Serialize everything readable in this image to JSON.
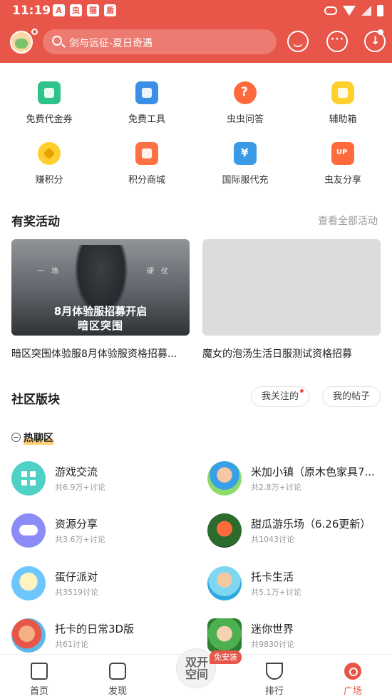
{
  "status_bar": {
    "time": "11:19",
    "icons": [
      "A",
      "虫",
      "猫",
      "盾"
    ]
  },
  "header": {
    "search_placeholder": "剑与远征-夏日奇遇"
  },
  "tools": [
    {
      "label": "免费代金券",
      "icon": "ticket-icon"
    },
    {
      "label": "免费工具",
      "icon": "wrench-icon"
    },
    {
      "label": "虫虫问答",
      "icon": "question-icon"
    },
    {
      "label": "辅助箱",
      "icon": "helper-icon"
    },
    {
      "label": "赚积分",
      "icon": "coin-icon"
    },
    {
      "label": "积分商城",
      "icon": "mall-icon"
    },
    {
      "label": "国际服代充",
      "icon": "yen-icon"
    },
    {
      "label": "虫友分享",
      "icon": "up-icon"
    }
  ],
  "activities": {
    "title": "有奖活动",
    "more": "查看全部活动",
    "items": [
      {
        "caption": "暗区突围体验服8月体验服资格招募...",
        "banner_side_left": "一　场",
        "banner_side_right": "硬　仗",
        "banner_headline": "8月体验服招募开启",
        "banner_logo": "暗区突围"
      },
      {
        "caption": "魔女的泡汤生活日服测试资格招募"
      }
    ]
  },
  "community": {
    "title": "社区版块",
    "followed": "我关注的",
    "my_posts": "我的帖子",
    "hot_label": "热聊区",
    "forums": [
      {
        "name": "游戏交流",
        "count": "共6.9万+讨论",
        "icon": "grid-icon"
      },
      {
        "name": "米加小镇（原木色家具7...",
        "count": "共2.8万+讨论",
        "icon": "mijia-icon"
      },
      {
        "name": "资源分享",
        "count": "共3.6万+讨论",
        "icon": "gamepad-icon"
      },
      {
        "name": "甜瓜游乐场（6.26更新）",
        "count": "共1043讨论",
        "icon": "melon-icon"
      },
      {
        "name": "蛋仔派对",
        "count": "共3519讨论",
        "icon": "eggy-icon"
      },
      {
        "name": "托卡生活",
        "count": "共5.1万+讨论",
        "icon": "toca-icon"
      },
      {
        "name": "托卡的日常3D版",
        "count": "共61讨论",
        "icon": "toca3d-icon"
      },
      {
        "name": "迷你世界",
        "count": "共9830讨论",
        "icon": "mini-world-icon"
      }
    ]
  },
  "bottom_nav": {
    "items": [
      {
        "label": "首页"
      },
      {
        "label": "发现"
      },
      {
        "label": "排行"
      },
      {
        "label": "广场"
      }
    ],
    "center_label_1": "双开",
    "center_label_2": "空间",
    "center_badge": "免安装",
    "active": "广场"
  },
  "colors": {
    "brand": "#e8564a",
    "text": "#222222",
    "muted": "#999999"
  }
}
